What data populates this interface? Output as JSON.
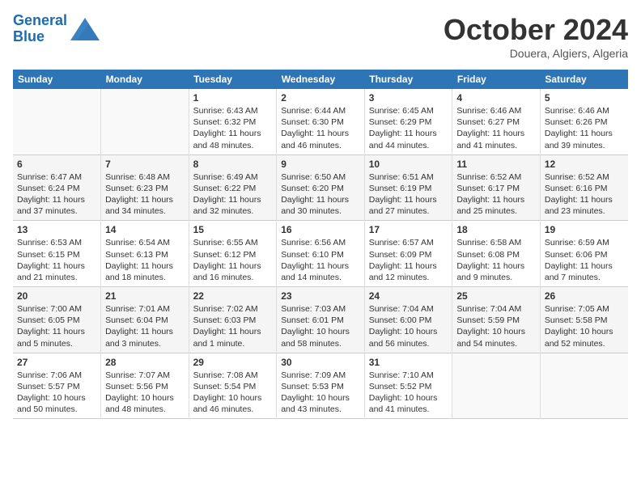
{
  "header": {
    "logo_line1": "General",
    "logo_line2": "Blue",
    "title": "October 2024",
    "subtitle": "Douera, Algiers, Algeria"
  },
  "days_of_week": [
    "Sunday",
    "Monday",
    "Tuesday",
    "Wednesday",
    "Thursday",
    "Friday",
    "Saturday"
  ],
  "weeks": [
    [
      {
        "day": "",
        "detail": ""
      },
      {
        "day": "",
        "detail": ""
      },
      {
        "day": "1",
        "detail": "Sunrise: 6:43 AM\nSunset: 6:32 PM\nDaylight: 11 hours and 48 minutes."
      },
      {
        "day": "2",
        "detail": "Sunrise: 6:44 AM\nSunset: 6:30 PM\nDaylight: 11 hours and 46 minutes."
      },
      {
        "day": "3",
        "detail": "Sunrise: 6:45 AM\nSunset: 6:29 PM\nDaylight: 11 hours and 44 minutes."
      },
      {
        "day": "4",
        "detail": "Sunrise: 6:46 AM\nSunset: 6:27 PM\nDaylight: 11 hours and 41 minutes."
      },
      {
        "day": "5",
        "detail": "Sunrise: 6:46 AM\nSunset: 6:26 PM\nDaylight: 11 hours and 39 minutes."
      }
    ],
    [
      {
        "day": "6",
        "detail": "Sunrise: 6:47 AM\nSunset: 6:24 PM\nDaylight: 11 hours and 37 minutes."
      },
      {
        "day": "7",
        "detail": "Sunrise: 6:48 AM\nSunset: 6:23 PM\nDaylight: 11 hours and 34 minutes."
      },
      {
        "day": "8",
        "detail": "Sunrise: 6:49 AM\nSunset: 6:22 PM\nDaylight: 11 hours and 32 minutes."
      },
      {
        "day": "9",
        "detail": "Sunrise: 6:50 AM\nSunset: 6:20 PM\nDaylight: 11 hours and 30 minutes."
      },
      {
        "day": "10",
        "detail": "Sunrise: 6:51 AM\nSunset: 6:19 PM\nDaylight: 11 hours and 27 minutes."
      },
      {
        "day": "11",
        "detail": "Sunrise: 6:52 AM\nSunset: 6:17 PM\nDaylight: 11 hours and 25 minutes."
      },
      {
        "day": "12",
        "detail": "Sunrise: 6:52 AM\nSunset: 6:16 PM\nDaylight: 11 hours and 23 minutes."
      }
    ],
    [
      {
        "day": "13",
        "detail": "Sunrise: 6:53 AM\nSunset: 6:15 PM\nDaylight: 11 hours and 21 minutes."
      },
      {
        "day": "14",
        "detail": "Sunrise: 6:54 AM\nSunset: 6:13 PM\nDaylight: 11 hours and 18 minutes."
      },
      {
        "day": "15",
        "detail": "Sunrise: 6:55 AM\nSunset: 6:12 PM\nDaylight: 11 hours and 16 minutes."
      },
      {
        "day": "16",
        "detail": "Sunrise: 6:56 AM\nSunset: 6:10 PM\nDaylight: 11 hours and 14 minutes."
      },
      {
        "day": "17",
        "detail": "Sunrise: 6:57 AM\nSunset: 6:09 PM\nDaylight: 11 hours and 12 minutes."
      },
      {
        "day": "18",
        "detail": "Sunrise: 6:58 AM\nSunset: 6:08 PM\nDaylight: 11 hours and 9 minutes."
      },
      {
        "day": "19",
        "detail": "Sunrise: 6:59 AM\nSunset: 6:06 PM\nDaylight: 11 hours and 7 minutes."
      }
    ],
    [
      {
        "day": "20",
        "detail": "Sunrise: 7:00 AM\nSunset: 6:05 PM\nDaylight: 11 hours and 5 minutes."
      },
      {
        "day": "21",
        "detail": "Sunrise: 7:01 AM\nSunset: 6:04 PM\nDaylight: 11 hours and 3 minutes."
      },
      {
        "day": "22",
        "detail": "Sunrise: 7:02 AM\nSunset: 6:03 PM\nDaylight: 11 hours and 1 minute."
      },
      {
        "day": "23",
        "detail": "Sunrise: 7:03 AM\nSunset: 6:01 PM\nDaylight: 10 hours and 58 minutes."
      },
      {
        "day": "24",
        "detail": "Sunrise: 7:04 AM\nSunset: 6:00 PM\nDaylight: 10 hours and 56 minutes."
      },
      {
        "day": "25",
        "detail": "Sunrise: 7:04 AM\nSunset: 5:59 PM\nDaylight: 10 hours and 54 minutes."
      },
      {
        "day": "26",
        "detail": "Sunrise: 7:05 AM\nSunset: 5:58 PM\nDaylight: 10 hours and 52 minutes."
      }
    ],
    [
      {
        "day": "27",
        "detail": "Sunrise: 7:06 AM\nSunset: 5:57 PM\nDaylight: 10 hours and 50 minutes."
      },
      {
        "day": "28",
        "detail": "Sunrise: 7:07 AM\nSunset: 5:56 PM\nDaylight: 10 hours and 48 minutes."
      },
      {
        "day": "29",
        "detail": "Sunrise: 7:08 AM\nSunset: 5:54 PM\nDaylight: 10 hours and 46 minutes."
      },
      {
        "day": "30",
        "detail": "Sunrise: 7:09 AM\nSunset: 5:53 PM\nDaylight: 10 hours and 43 minutes."
      },
      {
        "day": "31",
        "detail": "Sunrise: 7:10 AM\nSunset: 5:52 PM\nDaylight: 10 hours and 41 minutes."
      },
      {
        "day": "",
        "detail": ""
      },
      {
        "day": "",
        "detail": ""
      }
    ]
  ]
}
